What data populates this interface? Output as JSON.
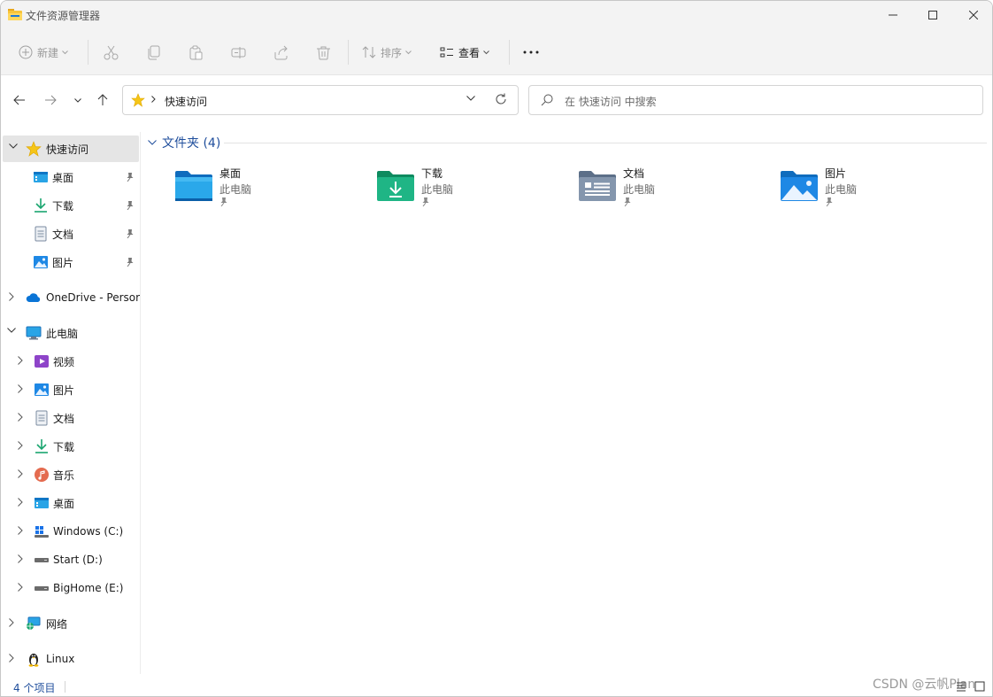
{
  "window": {
    "title": "文件资源管理器"
  },
  "toolbar": {
    "new_label": "新建",
    "sort_label": "排序",
    "view_label": "查看",
    "more_label": "···"
  },
  "address": {
    "crumb": "快速访问",
    "search_placeholder": "在 快速访问 中搜索"
  },
  "sidebar": {
    "quick_access": "快速访问",
    "pinned": [
      {
        "label": "桌面",
        "icon": "desktop-icon"
      },
      {
        "label": "下载",
        "icon": "download-icon"
      },
      {
        "label": "文档",
        "icon": "document-icon"
      },
      {
        "label": "图片",
        "icon": "picture-icon"
      }
    ],
    "onedrive": "OneDrive - Persor",
    "this_pc": "此电脑",
    "pc_items": [
      {
        "label": "视频",
        "icon": "video-icon"
      },
      {
        "label": "图片",
        "icon": "picture-icon"
      },
      {
        "label": "文档",
        "icon": "document-icon"
      },
      {
        "label": "下载",
        "icon": "download-icon"
      },
      {
        "label": "音乐",
        "icon": "music-icon"
      },
      {
        "label": "桌面",
        "icon": "desktop-icon"
      },
      {
        "label": "Windows (C:)",
        "icon": "windows-drive-icon"
      },
      {
        "label": "Start (D:)",
        "icon": "drive-icon"
      },
      {
        "label": "BigHome (E:)",
        "icon": "drive-icon"
      }
    ],
    "network": "网络",
    "linux": "Linux"
  },
  "content": {
    "group_title": "文件夹 (4)",
    "folders": [
      {
        "name": "桌面",
        "location": "此电脑",
        "icon": "desktop-folder-icon"
      },
      {
        "name": "下载",
        "location": "此电脑",
        "icon": "download-folder-icon"
      },
      {
        "name": "文档",
        "location": "此电脑",
        "icon": "document-folder-icon"
      },
      {
        "name": "图片",
        "location": "此电脑",
        "icon": "picture-folder-icon"
      }
    ]
  },
  "status": {
    "item_count": "4 个项目"
  },
  "watermark": "CSDN @云帆Plan",
  "colors": {
    "accent": "#1f4e9c",
    "selected_bg": "#e5e5e5",
    "chrome_bg": "#f3f3f3",
    "star": "#f5c518"
  }
}
